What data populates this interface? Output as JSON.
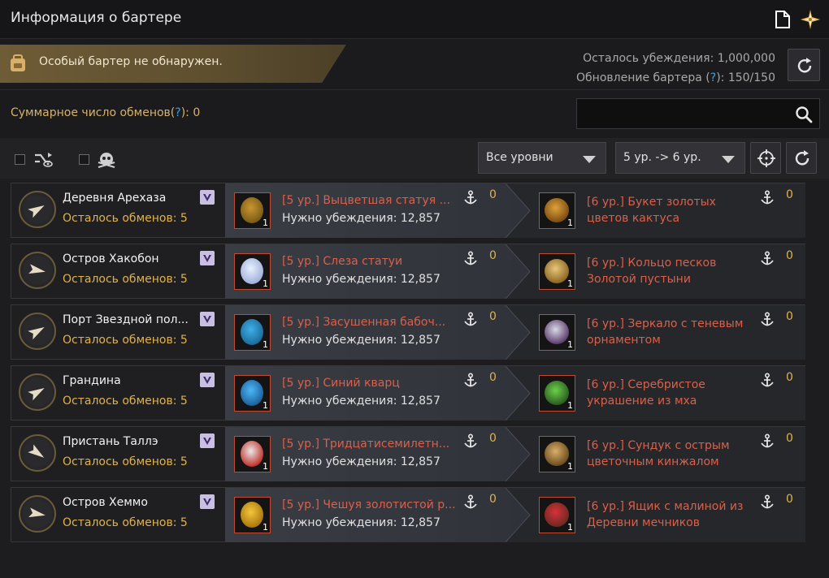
{
  "window": {
    "title": "Информация о бартере"
  },
  "notice": {
    "text": "Особый бартер не обнаружен."
  },
  "persuasion": {
    "remaining_label": "Осталось убеждения: 1,000,000",
    "refresh_label_prefix": "Обновление бартера (",
    "refresh_label_q": "?",
    "refresh_label_suffix": "): 150/150"
  },
  "total": {
    "prefix": "Суммарное число обменов(",
    "q": "?",
    "suffix": "): 0"
  },
  "search": {
    "value": "",
    "placeholder": ""
  },
  "filters": {
    "level_select": "Все уровни",
    "tier_select": "5 ур. -> 6 ур."
  },
  "colors": {
    "accent_gold": "#e0b24b",
    "item_red": "#d9604a",
    "help_blue": "#3aa0e0"
  },
  "rows": [
    {
      "town": "Деревня Арехаза",
      "left": "Осталось обменов: 5",
      "give": "[5 ур.] Выцветшая статуя ...",
      "need": "Нужно убеждения: 12,857",
      "give_anchor": "0",
      "give_count": "1",
      "get1": "[6 ур.] Букет золотых",
      "get2": "цветов кактуса",
      "get_anchor": "0",
      "get_count": "1",
      "give_icon": "dragon-statue-icon",
      "get_icon": "cactus-bouquet-icon"
    },
    {
      "town": "Остров Хакобон",
      "left": "Осталось обменов: 5",
      "give": "[5 ур.] Слеза статуи",
      "need": "Нужно убеждения: 12,857",
      "give_anchor": "0",
      "give_count": "1",
      "get1": "[6 ур.] Кольцо песков",
      "get2": "Золотой пустыни",
      "get_anchor": "0",
      "get_count": "1",
      "give_icon": "statue-tear-icon",
      "get_icon": "sand-ring-icon"
    },
    {
      "town": "Порт Звездной пол...",
      "left": "Осталось обменов: 5",
      "give": "[5 ур.] Засушенная бабоч...",
      "need": "Нужно убеждения: 12,857",
      "give_anchor": "0",
      "give_count": "1",
      "get1": "[6 ур.] Зеркало с теневым",
      "get2": "орнаментом",
      "get_anchor": "0",
      "get_count": "1",
      "give_icon": "butterfly-icon",
      "get_icon": "mirror-icon"
    },
    {
      "town": "Грандина",
      "left": "Осталось обменов: 5",
      "give": "[5 ур.] Синий кварц",
      "need": "Нужно убеждения: 12,857",
      "give_anchor": "0",
      "give_count": "1",
      "get1": "[6 ур.] Серебристое",
      "get2": "украшение из мха",
      "get_anchor": "0",
      "get_count": "1",
      "give_icon": "blue-quartz-icon",
      "get_icon": "moss-ornament-icon"
    },
    {
      "town": "Пристань Таллэ",
      "left": "Осталось обменов: 5",
      "give": "[5 ур.] Тридцатисемилетн...",
      "need": "Нужно убеждения: 12,857",
      "give_anchor": "0",
      "give_count": "1",
      "get1": "[6 ур.] Сундук с острым",
      "get2": "цветочным кинжалом",
      "get_anchor": "0",
      "get_count": "1",
      "give_icon": "emblem-icon",
      "get_icon": "treasure-chest-icon"
    },
    {
      "town": "Остров Хеммо",
      "left": "Осталось обменов: 5",
      "give": "[5 ур.] Чешуя золотистой р...",
      "need": "Нужно убеждения: 12,857",
      "give_anchor": "0",
      "give_count": "1",
      "get1": "[6 ур.] Ящик с малиной из",
      "get2": "Деревни мечников",
      "get_anchor": "0",
      "get_count": "1",
      "give_icon": "golden-scale-icon",
      "get_icon": "raspberry-box-icon"
    }
  ]
}
